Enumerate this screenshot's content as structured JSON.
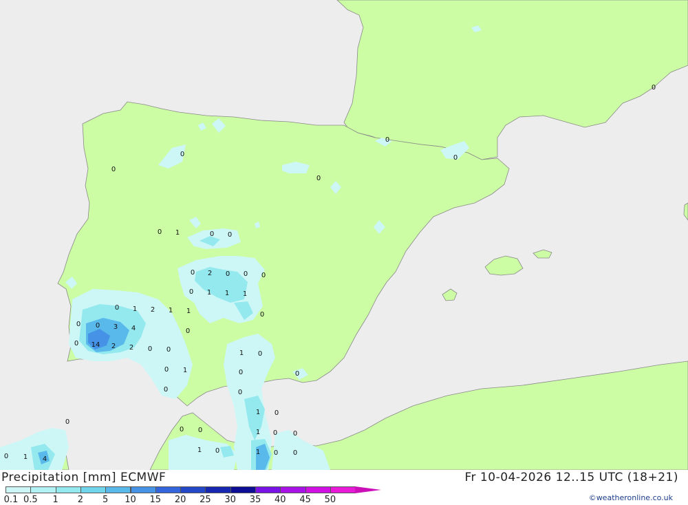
{
  "header": {
    "title": "Precipitation [mm] ECMWF",
    "valid_time": "Fr 10-04-2026 12..15 UTC (18+21)",
    "credit": "©weatheronline.co.uk"
  },
  "colors": {
    "sea": "#ededed",
    "land": "#ccfca4",
    "coast": "#888888"
  },
  "legend": {
    "ticks": [
      "0.1",
      "0.5",
      "1",
      "2",
      "5",
      "10",
      "15",
      "20",
      "25",
      "30",
      "35",
      "40",
      "45",
      "50"
    ],
    "swatches": [
      "#cdf7f7",
      "#b2f2f4",
      "#93e9ee",
      "#70d6ec",
      "#58b9ea",
      "#4592e6",
      "#3366dd",
      "#2447c7",
      "#1727b0",
      "#0d0d96",
      "#7a14e6",
      "#a713e6",
      "#d010e3",
      "#e81ad8",
      "#cc10b8"
    ]
  },
  "map_labels": [
    {
      "text": "0"
    },
    {
      "text": "0"
    },
    {
      "text": "0"
    },
    {
      "text": "0"
    },
    {
      "text": "0"
    },
    {
      "text": "0"
    },
    {
      "text": "0"
    },
    {
      "text": "0"
    },
    {
      "text": "1"
    },
    {
      "text": "0"
    },
    {
      "text": "0"
    },
    {
      "text": "0"
    },
    {
      "text": "2"
    },
    {
      "text": "0"
    },
    {
      "text": "0"
    },
    {
      "text": "0"
    },
    {
      "text": "0"
    },
    {
      "text": "1"
    },
    {
      "text": "1"
    },
    {
      "text": "1"
    },
    {
      "text": "0"
    },
    {
      "text": "1"
    },
    {
      "text": "2"
    },
    {
      "text": "1"
    },
    {
      "text": "1"
    },
    {
      "text": "0"
    },
    {
      "text": "0"
    },
    {
      "text": "0"
    },
    {
      "text": "3"
    },
    {
      "text": "4"
    },
    {
      "text": "0"
    },
    {
      "text": "14"
    },
    {
      "text": "2"
    },
    {
      "text": "2"
    },
    {
      "text": "0"
    },
    {
      "text": "0"
    },
    {
      "text": "0"
    },
    {
      "text": "1"
    },
    {
      "text": "0"
    },
    {
      "text": "0"
    },
    {
      "text": "1"
    },
    {
      "text": "0"
    },
    {
      "text": "0"
    },
    {
      "text": "0"
    },
    {
      "text": "0"
    },
    {
      "text": "0"
    },
    {
      "text": "1"
    },
    {
      "text": "0"
    },
    {
      "text": "0"
    },
    {
      "text": "1"
    },
    {
      "text": "0"
    },
    {
      "text": "0"
    },
    {
      "text": "1"
    },
    {
      "text": "0"
    },
    {
      "text": "1"
    },
    {
      "text": "0"
    },
    {
      "text": "0"
    },
    {
      "text": "0"
    },
    {
      "text": "1"
    },
    {
      "text": "4"
    }
  ]
}
